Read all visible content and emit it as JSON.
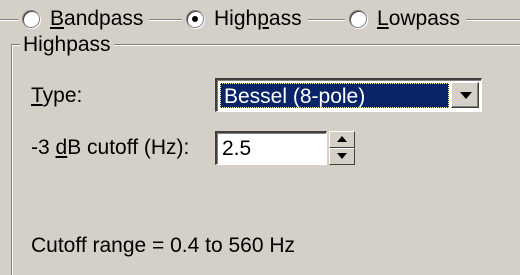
{
  "filter_mode": {
    "options": [
      {
        "prefix": "",
        "mnemonic": "B",
        "suffix": "andpass",
        "selected": false
      },
      {
        "prefix": "High",
        "mnemonic": "p",
        "suffix": "ass",
        "selected": true
      },
      {
        "prefix": "",
        "mnemonic": "L",
        "suffix": "owpass",
        "selected": false
      }
    ]
  },
  "group": {
    "title": "Highpass",
    "type_label": {
      "mnemonic": "T",
      "rest": "ype:"
    },
    "type_value": "Bessel (8-pole)",
    "cutoff_label": {
      "prefix": "-3 ",
      "mnemonic": "d",
      "rest": "B cutoff (Hz):"
    },
    "cutoff_value": "2.5",
    "range_text": "Cutoff range = 0.4 to 560 Hz"
  },
  "colors": {
    "face": "#d4d0c8",
    "selection": "#0a246a",
    "field": "#ffffff"
  }
}
